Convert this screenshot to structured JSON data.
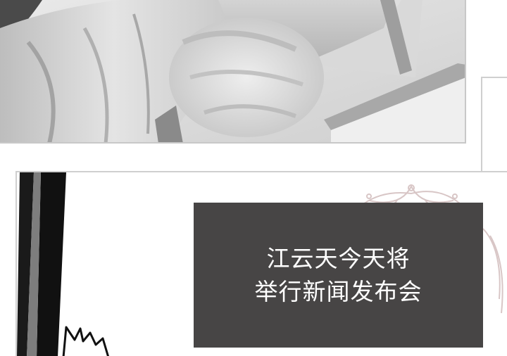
{
  "caption": {
    "line1": "江云天今天将",
    "line2": "举行新闻发布会"
  },
  "colors": {
    "caption_background": "#474545",
    "caption_text": "#ffffff",
    "page_background": "#ffffff"
  }
}
